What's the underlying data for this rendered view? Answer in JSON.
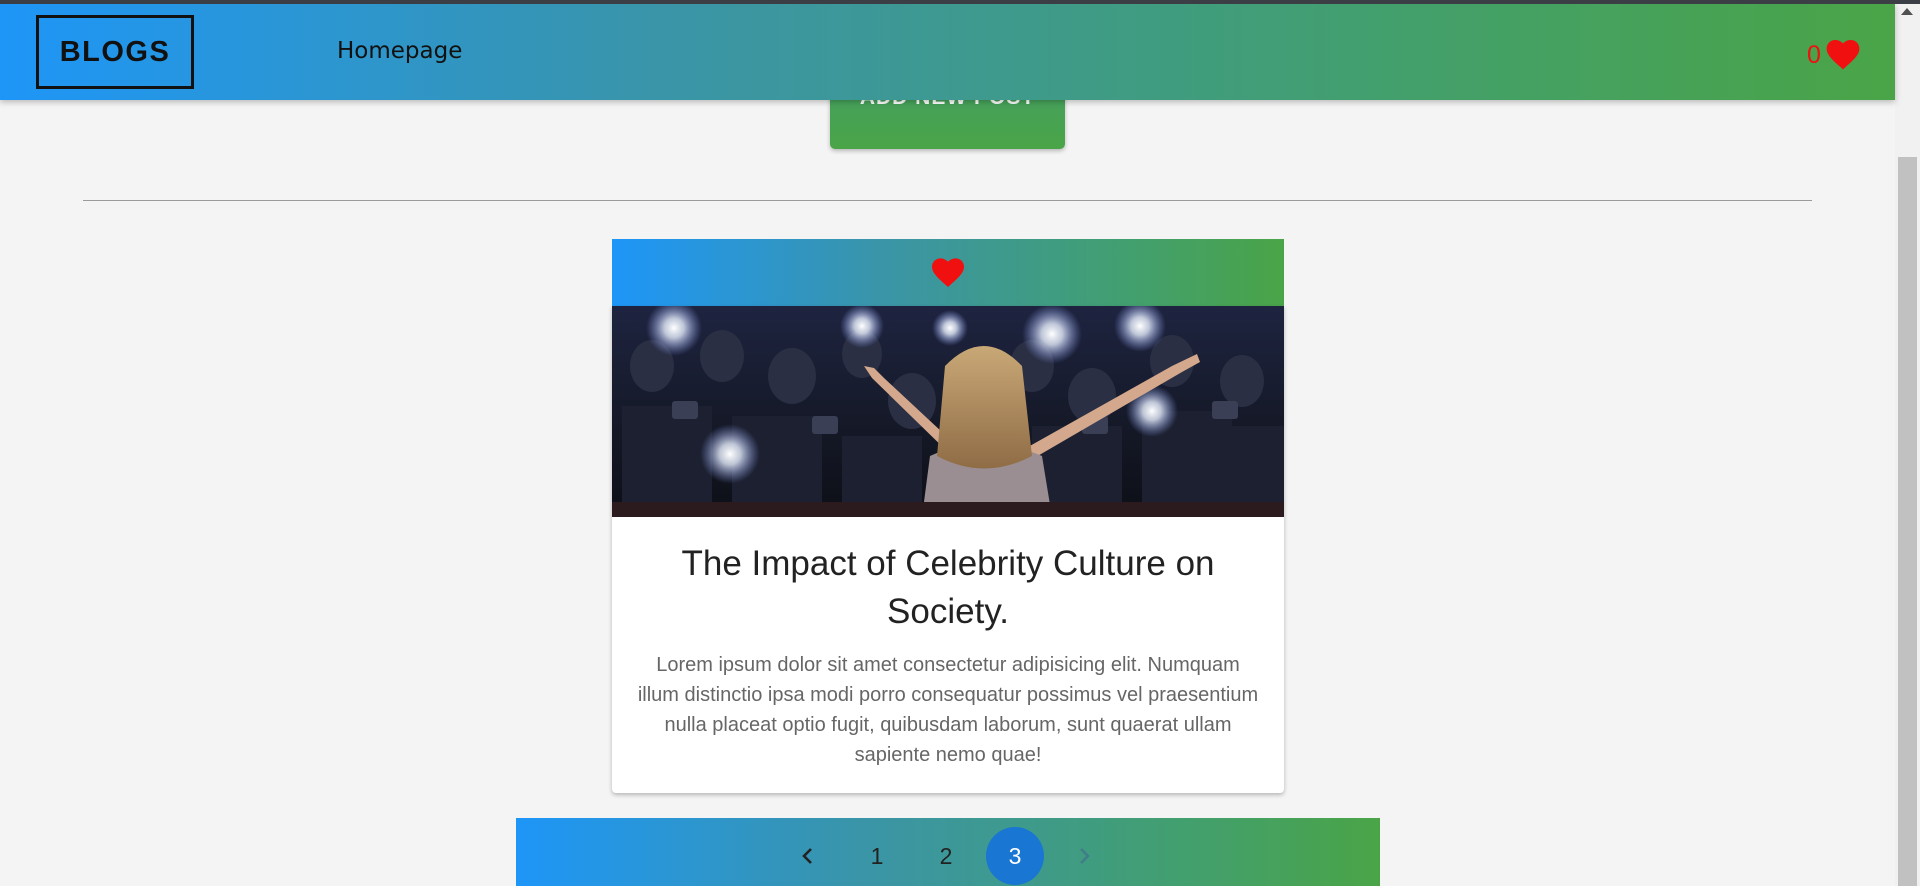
{
  "navbar": {
    "brand": "BLOGS",
    "links": [
      "Homepage"
    ],
    "favorites_count": "0",
    "gradient": [
      "#1e96f8",
      "#4aa447"
    ]
  },
  "actions": {
    "add_post_label": "ADD NEW POST"
  },
  "post": {
    "image_alt": "Woman on stage with arms outstretched facing a crowd of photographers with camera flashes",
    "title": "The Impact of Celebrity Culture on Society.",
    "body": "Lorem ipsum dolor sit amet consectetur adipisicing elit. Numquam illum distinctio ipsa modi porro consequatur possimus vel praesentium nulla placeat optio fugit, quibusdam laborum, sunt quaerat ullam sapiente nemo quae!",
    "favorite_icon": "heart-icon"
  },
  "pagination": {
    "prev_icon": "chevron-left-icon",
    "next_icon": "chevron-right-icon",
    "pages": [
      "1",
      "2",
      "3"
    ],
    "current": "3"
  },
  "colors": {
    "heart": "#f01010",
    "active_page": "#1976d2"
  }
}
